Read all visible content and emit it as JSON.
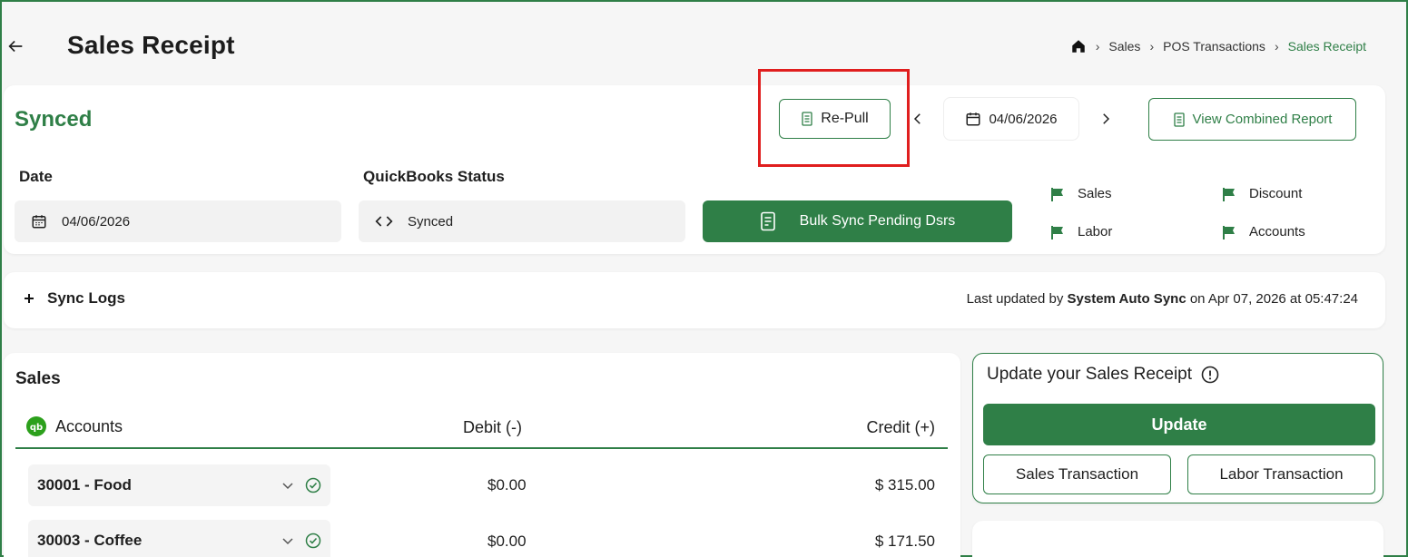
{
  "header": {
    "title": "Sales Receipt",
    "breadcrumb": [
      "Sales",
      "POS Transactions",
      "Sales Receipt"
    ]
  },
  "top": {
    "status": "Synced",
    "repull_label": "Re-Pull",
    "nav_date": "04/06/2026",
    "combined_label": "View Combined Report",
    "date_label": "Date",
    "date_value": "04/06/2026",
    "qb_label": "QuickBooks Status",
    "qb_value": "Synced",
    "bulk_label": "Bulk Sync Pending Dsrs",
    "flags": [
      "Sales",
      "Discount",
      "Labor",
      "Accounts"
    ]
  },
  "logs": {
    "label": "Sync Logs",
    "prefix": "Last updated by",
    "user": "System Auto Sync",
    "suffix": "on Apr 07, 2026 at 05:47:24"
  },
  "sales": {
    "title": "Sales",
    "columns": [
      "Accounts",
      "Debit (-)",
      "Credit (+)"
    ],
    "rows": [
      {
        "account": "30001 - Food",
        "debit": "$0.00",
        "credit": "$ 315.00"
      },
      {
        "account": "30003 - Coffee",
        "debit": "$0.00",
        "credit": "$ 171.50"
      }
    ]
  },
  "update": {
    "title": "Update your Sales Receipt",
    "update_label": "Update",
    "sales_tx_label": "Sales Transaction",
    "labor_tx_label": "Labor Transaction"
  },
  "colors": {
    "accent": "#2f7f47",
    "highlight": "#e01e1e",
    "background": "#f6f6f6"
  },
  "icons": [
    "back-arrow-icon",
    "home-icon",
    "receipt-icon",
    "calendar-icon",
    "code-icon",
    "flag-icon",
    "quickbooks-icon",
    "chevron-down-icon",
    "check-circle-icon",
    "info-icon",
    "plus-icon"
  ]
}
